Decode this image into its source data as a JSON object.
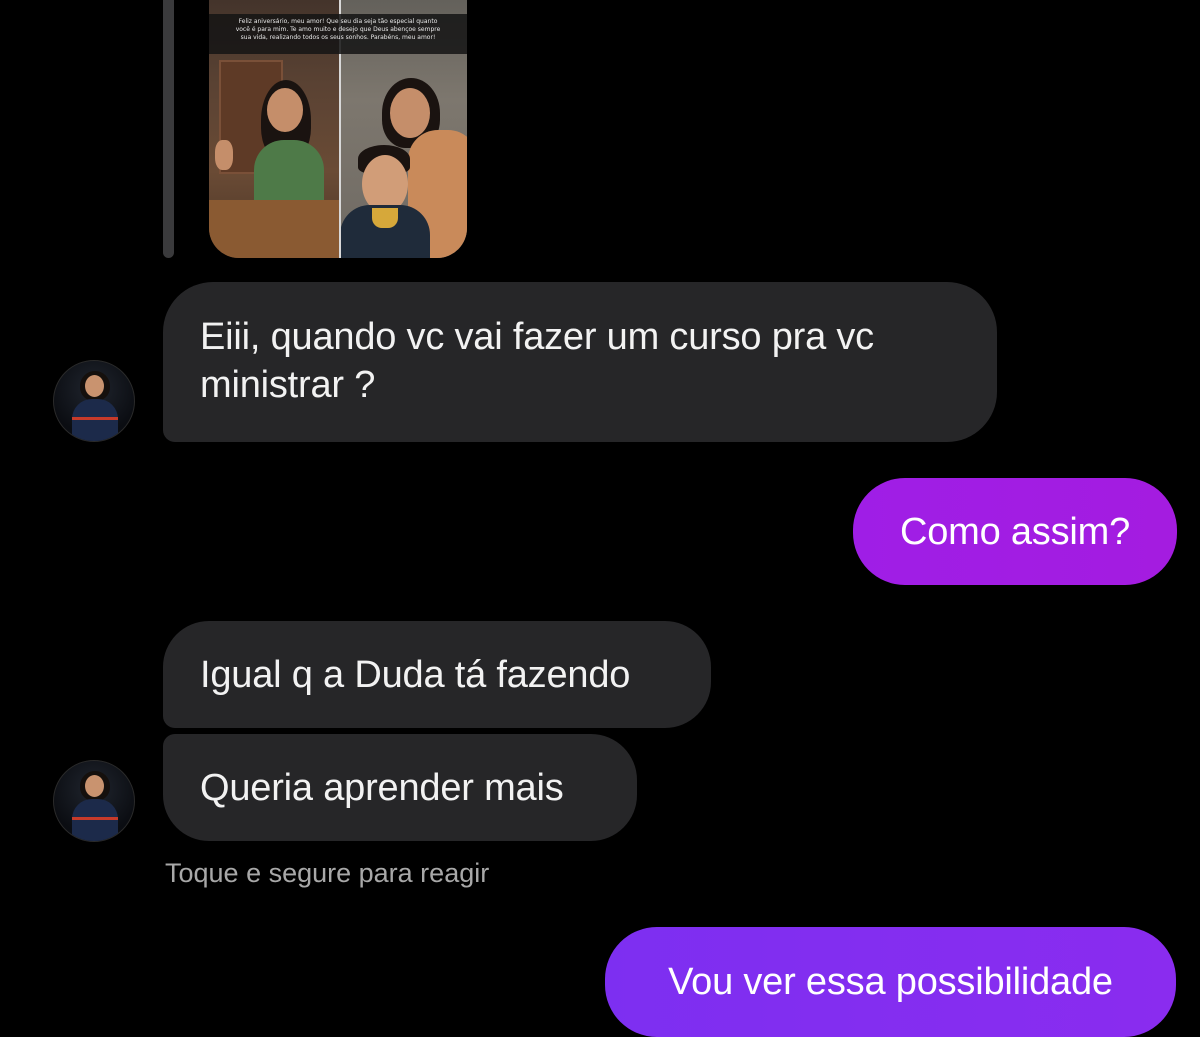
{
  "story_reply": {
    "caption": "Feliz aniversário, meu amor! Que seu dia seja tão especial quanto você é para mim. Te amo muito e desejo que Deus abençoe sempre sua vida, realizando todos os seus sonhos. Parabéns, meu amor!"
  },
  "messages": [
    {
      "text": "Eiii, quando vc vai fazer um curso pra vc ministrar ?"
    },
    {
      "text": "Como assim?"
    },
    {
      "text": "Igual q a Duda tá fazendo"
    },
    {
      "text": "Queria aprender mais"
    },
    {
      "text": "Vou ver essa possibilidade"
    }
  ],
  "hint": "Toque e segure para reagir",
  "colors": {
    "incoming_bubble": "#262628",
    "outgoing_bubble_1": "#a01ee4",
    "outgoing_bubble_2": "#842ef0",
    "background": "#000000"
  },
  "icons": {
    "avatar": "contact-avatar"
  }
}
